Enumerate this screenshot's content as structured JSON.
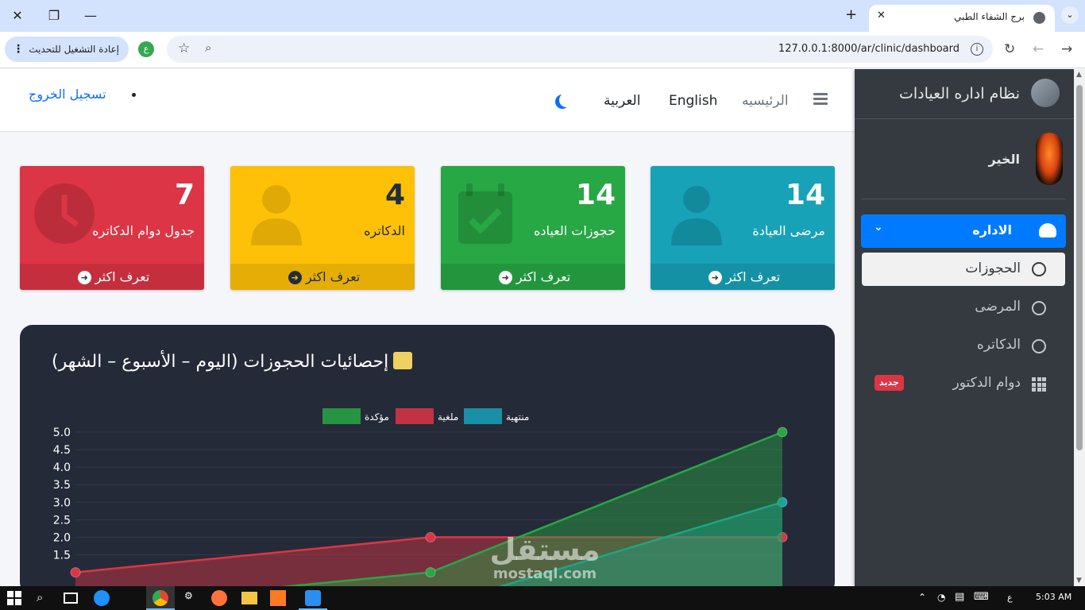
{
  "browser": {
    "tab_title": "برج الشفاء الطبي",
    "url": "127.0.0.1:8000/ar/clinic/dashboard",
    "update_button": "إعادة التشغيل للتحديث",
    "profile_initial": "ع",
    "window_close": "✕",
    "window_restore": "❐",
    "window_minimize": "—",
    "new_tab": "+",
    "tab_close": "✕",
    "tab_list": "⌄"
  },
  "navbar": {
    "home": "الرئيسيه",
    "english": "English",
    "arabic": "العربية",
    "logout": "تسجيل الخروج"
  },
  "cards": [
    {
      "number": "14",
      "label": "مرضى العيادة",
      "footer": "تعرف اكثر",
      "color": "#17a2b8",
      "icon": "user-injured-icon"
    },
    {
      "number": "14",
      "label": "حجوزات العياده",
      "footer": "تعرف اكثر",
      "color": "#28a745",
      "icon": "calendar-check-icon"
    },
    {
      "number": "4",
      "label": "الدكاتره",
      "footer": "تعرف اكثر",
      "color": "#ffc107",
      "icon": "user-doctor-icon"
    },
    {
      "number": "7",
      "label": "جدول دوام الدكاتره",
      "footer": "تعرف اكثر",
      "color": "#dc3545",
      "icon": "clock-icon"
    }
  ],
  "chart_title": "إحصائيات الحجوزات (اليوم – الأسبوع – الشهر)",
  "chart_data": {
    "type": "line",
    "title": "إحصائيات الحجوزات (اليوم – الأسبوع – الشهر)",
    "legend_position": "top",
    "y_ticks": [
      "5.0",
      "4.5",
      "4.0",
      "3.5",
      "3.0",
      "2.5",
      "2.0",
      "1.5"
    ],
    "ylim": [
      1.5,
      5.0
    ],
    "grid": true,
    "series": [
      {
        "name": "منتهية",
        "color": "#17a2b8",
        "values": [
          0,
          0,
          3
        ]
      },
      {
        "name": "ملغية",
        "color": "#dc3545",
        "values": [
          1,
          2,
          2
        ]
      },
      {
        "name": "مؤكدة",
        "color": "#28a745",
        "values": [
          0,
          1,
          5
        ]
      }
    ]
  },
  "sidebar": {
    "brand": "نظام اداره العيادات",
    "user": "الخير",
    "menu_main": "الاداره",
    "items": [
      {
        "label": "الحجوزات",
        "active": true
      },
      {
        "label": "المرضى",
        "active": false
      },
      {
        "label": "الدكاتره",
        "active": false
      },
      {
        "label": "دوام الدكتور",
        "active": false,
        "badge": "جديد"
      }
    ]
  },
  "watermark": {
    "line1": "مستقل",
    "line2": "mostaql.com"
  },
  "taskbar": {
    "time": "5:03 AM",
    "lang": "ع"
  }
}
